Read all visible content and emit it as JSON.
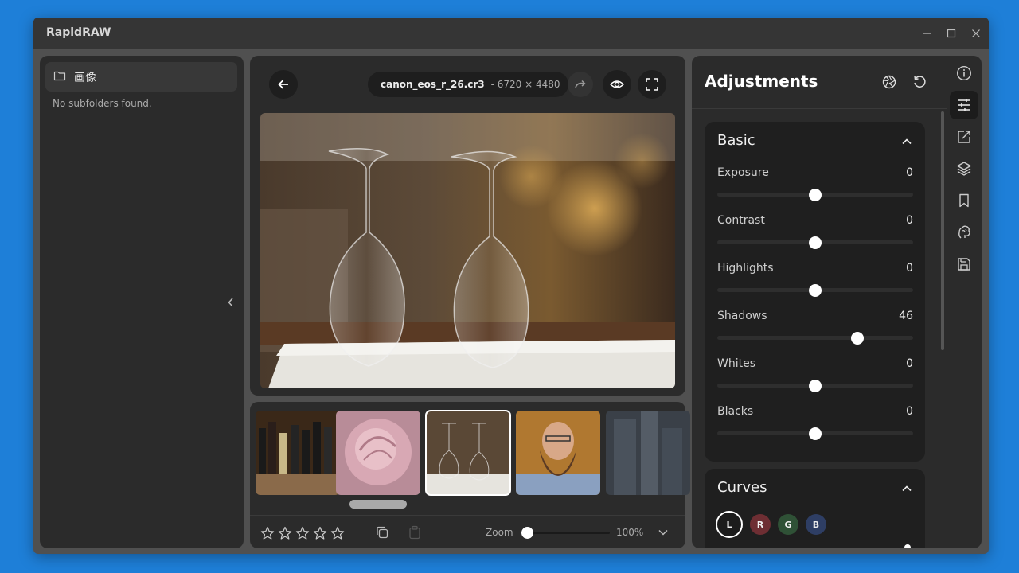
{
  "app": {
    "title": "RapidRAW"
  },
  "window_controls": {
    "minimize": "minimize-icon",
    "maximize": "maximize-icon",
    "close": "close-icon"
  },
  "sidebar": {
    "folder_label": "画像",
    "empty_message": "No subfolders found."
  },
  "viewer": {
    "file_name": "canon_eos_r_26.cr3",
    "file_dims": "- 6720 × 4480"
  },
  "filmstrip": {
    "thumbnails": [
      {
        "name": "wine-bottles",
        "selected": false
      },
      {
        "name": "rose",
        "selected": false
      },
      {
        "name": "wine-glasses",
        "selected": true
      },
      {
        "name": "bearded-man",
        "selected": false
      },
      {
        "name": "skyscrapers",
        "selected": false
      }
    ],
    "rating": 0,
    "zoom_label": "Zoom",
    "zoom_value": "100%",
    "zoom_fraction": 0.0
  },
  "adjustments": {
    "title": "Adjustments",
    "basic": {
      "title": "Basic",
      "sliders": [
        {
          "label": "Exposure",
          "value": "0",
          "fraction": 0.5
        },
        {
          "label": "Contrast",
          "value": "0",
          "fraction": 0.5
        },
        {
          "label": "Highlights",
          "value": "0",
          "fraction": 0.5
        },
        {
          "label": "Shadows",
          "value": "46",
          "fraction": 0.715
        },
        {
          "label": "Whites",
          "value": "0",
          "fraction": 0.5
        },
        {
          "label": "Blacks",
          "value": "0",
          "fraction": 0.5
        }
      ]
    },
    "curves": {
      "title": "Curves",
      "channels": [
        {
          "label": "L",
          "color": "#1c1c1c",
          "active": true
        },
        {
          "label": "R",
          "color": "#6e2e33",
          "active": false
        },
        {
          "label": "G",
          "color": "#2f5136",
          "active": false
        },
        {
          "label": "B",
          "color": "#2e3e64",
          "active": false
        }
      ]
    }
  },
  "toolbar": {
    "items": [
      {
        "name": "info-icon",
        "active": false
      },
      {
        "name": "adjustments-icon",
        "active": true
      },
      {
        "name": "crop-icon",
        "active": false
      },
      {
        "name": "layers-icon",
        "active": false
      },
      {
        "name": "bookmark-icon",
        "active": false
      },
      {
        "name": "ai-icon",
        "active": false
      },
      {
        "name": "save-icon",
        "active": false
      }
    ]
  },
  "colors": {
    "background": "#1e7fd8",
    "panel": "#2b2b2b",
    "section": "#1f1f1f",
    "accent": "#ffffff"
  }
}
